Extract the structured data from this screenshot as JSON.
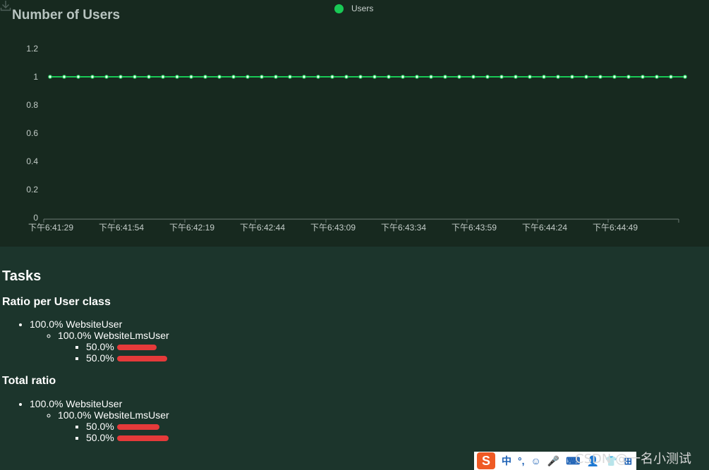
{
  "chart": {
    "title": "Number of Users",
    "legend_label": "Users",
    "line_color": "#19c955",
    "download_icon": "download-icon"
  },
  "chart_data": {
    "type": "line",
    "series": [
      {
        "name": "Users",
        "values": [
          1,
          1,
          1,
          1,
          1,
          1,
          1,
          1,
          1,
          1,
          1,
          1,
          1,
          1,
          1,
          1,
          1,
          1,
          1,
          1,
          1,
          1,
          1,
          1,
          1,
          1,
          1,
          1,
          1,
          1,
          1,
          1,
          1,
          1,
          1,
          1,
          1,
          1,
          1,
          1,
          1,
          1,
          1,
          1,
          1,
          1
        ]
      }
    ],
    "ylim": [
      0,
      1.2
    ],
    "yticks": [
      "0",
      "0.2",
      "0.4",
      "0.6",
      "0.8",
      "1",
      "1.2"
    ],
    "xtick_labels": [
      "下午6:41:29",
      "下午6:41:54",
      "下午6:42:19",
      "下午6:42:44",
      "下午6:43:09",
      "下午6:43:34",
      "下午6:43:59",
      "下午6:44:24",
      "下午6:44:49"
    ],
    "xtick_every_points": 5,
    "grid": false,
    "legend": "top-center"
  },
  "tasks": {
    "title": "Tasks",
    "ratio_section": {
      "title": "Ratio per User class",
      "user_class": "100.0% WebsiteUser",
      "sub_class": "100.0% WebsiteLmsUser",
      "items": [
        "50.0%",
        "50.0%"
      ]
    },
    "total_section": {
      "title": "Total ratio",
      "user_class": "100.0% WebsiteUser",
      "sub_class": "100.0% WebsiteLmsUser",
      "items": [
        "50.0%",
        "50.0%"
      ]
    }
  },
  "ime": {
    "logo": "S",
    "items": [
      "中",
      "°,",
      "☺",
      "🎤",
      "⌨",
      "👤",
      "👕",
      "⊞"
    ]
  },
  "watermark": "CSDN @一名小测试"
}
